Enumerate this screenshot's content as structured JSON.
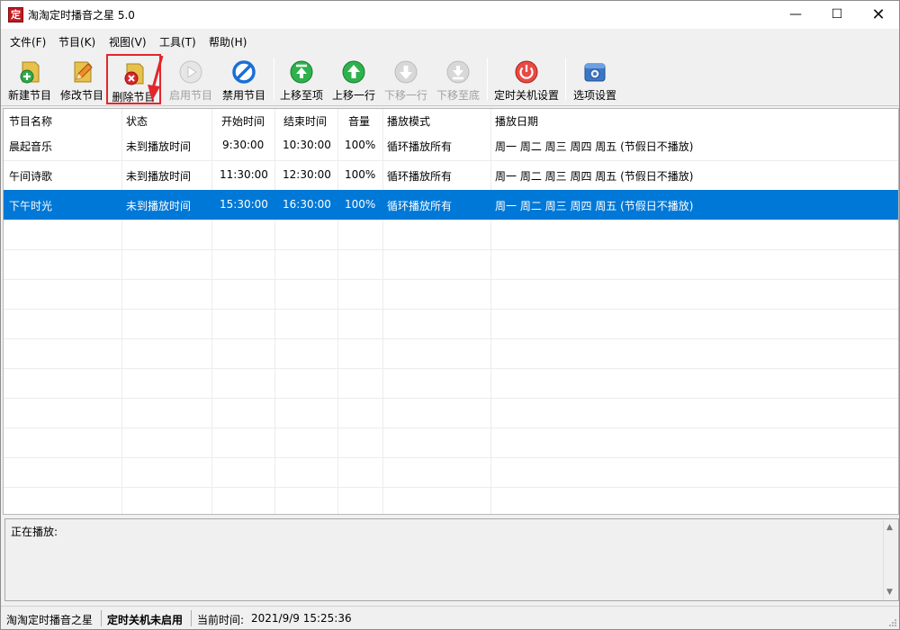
{
  "window": {
    "title": "淘淘定时播音之星 5.0",
    "app_icon_char": "定",
    "controls": {
      "minimize": "—",
      "maximize": "☐",
      "close": "✕"
    }
  },
  "menu": [
    "文件(F)",
    "节目(K)",
    "视图(V)",
    "工具(T)",
    "帮助(H)"
  ],
  "toolbar": {
    "new": "新建节目",
    "edit": "修改节目",
    "delete": "删除节目",
    "enable": "启用节目",
    "disable": "禁用节目",
    "move_top": "上移至项",
    "move_up": "上移一行",
    "move_down": "下移一行",
    "move_bottom": "下移至底",
    "shutdown": "定时关机设置",
    "options": "选项设置"
  },
  "colors": {
    "selection": "#0078d7",
    "highlight_box": "#e3262c",
    "annotation_arrow": "#e3262c"
  },
  "table": {
    "headers": [
      "节目名称",
      "状态",
      "开始时间",
      "结束时间",
      "音量",
      "播放模式",
      "播放日期"
    ],
    "rows": [
      [
        "晨起音乐",
        "未到播放时间",
        "9:30:00",
        "10:30:00",
        "100%",
        "循环播放所有",
        "周一 周二 周三 周四 周五 (节假日不播放)"
      ],
      [
        "午间诗歌",
        "未到播放时间",
        "11:30:00",
        "12:30:00",
        "100%",
        "循环播放所有",
        "周一 周二 周三 周四 周五 (节假日不播放)"
      ],
      [
        "下午时光",
        "未到播放时间",
        "15:30:00",
        "16:30:00",
        "100%",
        "循环播放所有",
        "周一 周二 周三 周四 周五 (节假日不播放)"
      ]
    ],
    "selected_row": 3
  },
  "play_panel": {
    "label": "正在播放:"
  },
  "status": {
    "app": "淘淘定时播音之星",
    "shutdown": "定时关机未启用",
    "time_label": "当前时间:",
    "time_value": "2021/9/9 15:25:36"
  }
}
